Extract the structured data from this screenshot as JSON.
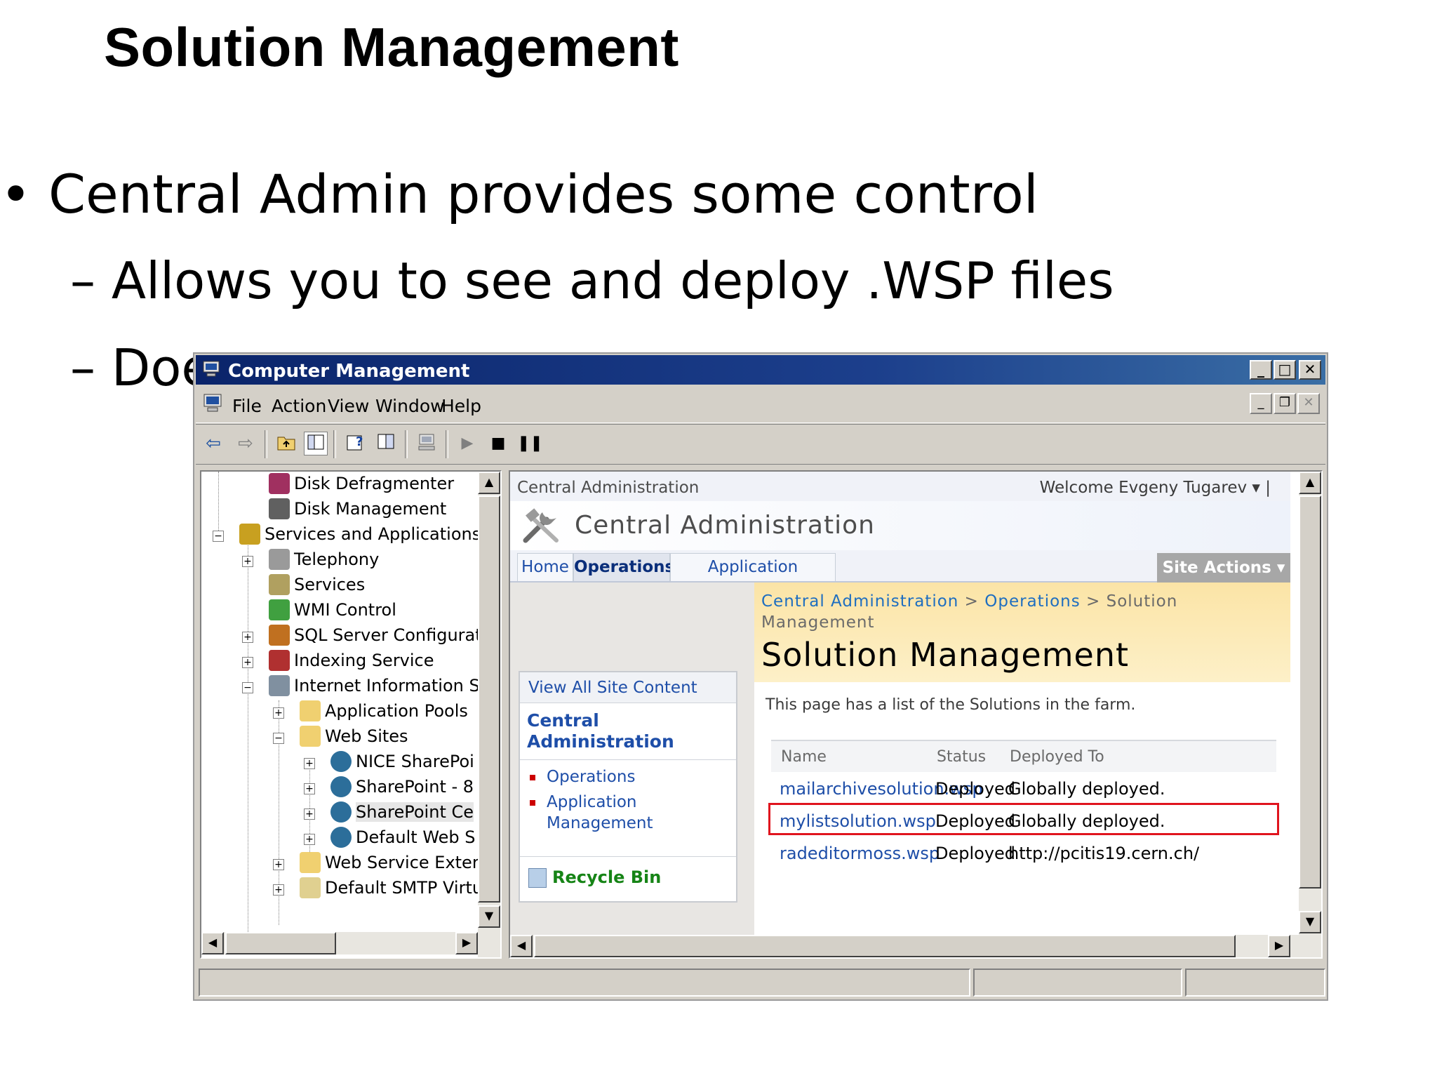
{
  "slide": {
    "title": "Solution Management",
    "bullet1": "• Central Admin provides some control",
    "bullet2": "– Allows you to see and deploy .WSP files",
    "bullet3": "– Doe"
  },
  "window": {
    "title": "Computer Management",
    "menu": [
      "File",
      "Action",
      "View",
      "Window",
      "Help"
    ],
    "controls": {
      "min": "_",
      "max": "□",
      "close": "✕",
      "restore": "❐"
    }
  },
  "tree": {
    "items": [
      {
        "label": "Disk Defragmenter",
        "icon": "disk-defragmenter-icon",
        "color": "#a03060"
      },
      {
        "label": "Disk Management",
        "icon": "disk-management-icon",
        "color": "#606060"
      },
      {
        "label": "Services and Applications",
        "icon": "services-apps-icon",
        "color": "#c8a020"
      },
      {
        "label": "Telephony",
        "icon": "telephony-icon",
        "color": "#9a9a9a"
      },
      {
        "label": "Services",
        "icon": "services-icon",
        "color": "#b0a060"
      },
      {
        "label": "WMI Control",
        "icon": "wmi-icon",
        "color": "#40a040"
      },
      {
        "label": "SQL Server Configurat",
        "icon": "sql-server-icon",
        "color": "#c07020"
      },
      {
        "label": "Indexing Service",
        "icon": "indexing-icon",
        "color": "#b03030"
      },
      {
        "label": "Internet Information S",
        "icon": "iis-icon",
        "color": "#8090a0"
      },
      {
        "label": "Application Pools",
        "icon": "folder-icon",
        "color": "#f0d070"
      },
      {
        "label": "Web Sites",
        "icon": "folder-icon",
        "color": "#f0d070"
      },
      {
        "label": "NICE SharePoi",
        "icon": "globe-icon",
        "color": "#2c6e9a"
      },
      {
        "label": "SharePoint - 8",
        "icon": "globe-icon",
        "color": "#2c6e9a"
      },
      {
        "label": "SharePoint Ce",
        "icon": "globe-icon",
        "color": "#2c6e9a"
      },
      {
        "label": "Default Web S",
        "icon": "globe-stopped-icon",
        "color": "#2c6e9a"
      },
      {
        "label": "Web Service Exter",
        "icon": "folder-icon",
        "color": "#f0d070"
      },
      {
        "label": "Default SMTP Virtu",
        "icon": "smtp-icon",
        "color": "#e0d090"
      }
    ]
  },
  "sharepoint": {
    "site_crumb": "Central Administration",
    "welcome": "Welcome Evgeny Tugarev ▾  |",
    "header_title": "Central Administration",
    "tabs": [
      "Home",
      "Operations",
      "Application Management"
    ],
    "site_actions": "Site Actions ▾",
    "breadcrumb": {
      "a": "Central Administration",
      "sep": ">",
      "b": "Operations",
      "c": "Solution Management"
    },
    "page_title": "Solution Management",
    "description": "This page has a list of the Solutions in the farm.",
    "quicklaunch": {
      "view_all": "View All Site Content",
      "heading": "Central Administration",
      "links": [
        "Operations",
        "Application Management"
      ],
      "recycle": "Recycle Bin"
    },
    "table": {
      "headers": [
        "Name",
        "Status",
        "Deployed To"
      ],
      "rows": [
        {
          "name": "mailarchivesolution.wsp",
          "status": "Deployed",
          "deployed_to": "Globally deployed."
        },
        {
          "name": "mylistsolution.wsp",
          "status": "Deployed",
          "deployed_to": "Globally deployed."
        },
        {
          "name": "radeditormoss.wsp",
          "status": "Deployed",
          "deployed_to": "http://pcitis19.cern.ch/"
        }
      ],
      "highlight_color": "#e0141e"
    }
  }
}
